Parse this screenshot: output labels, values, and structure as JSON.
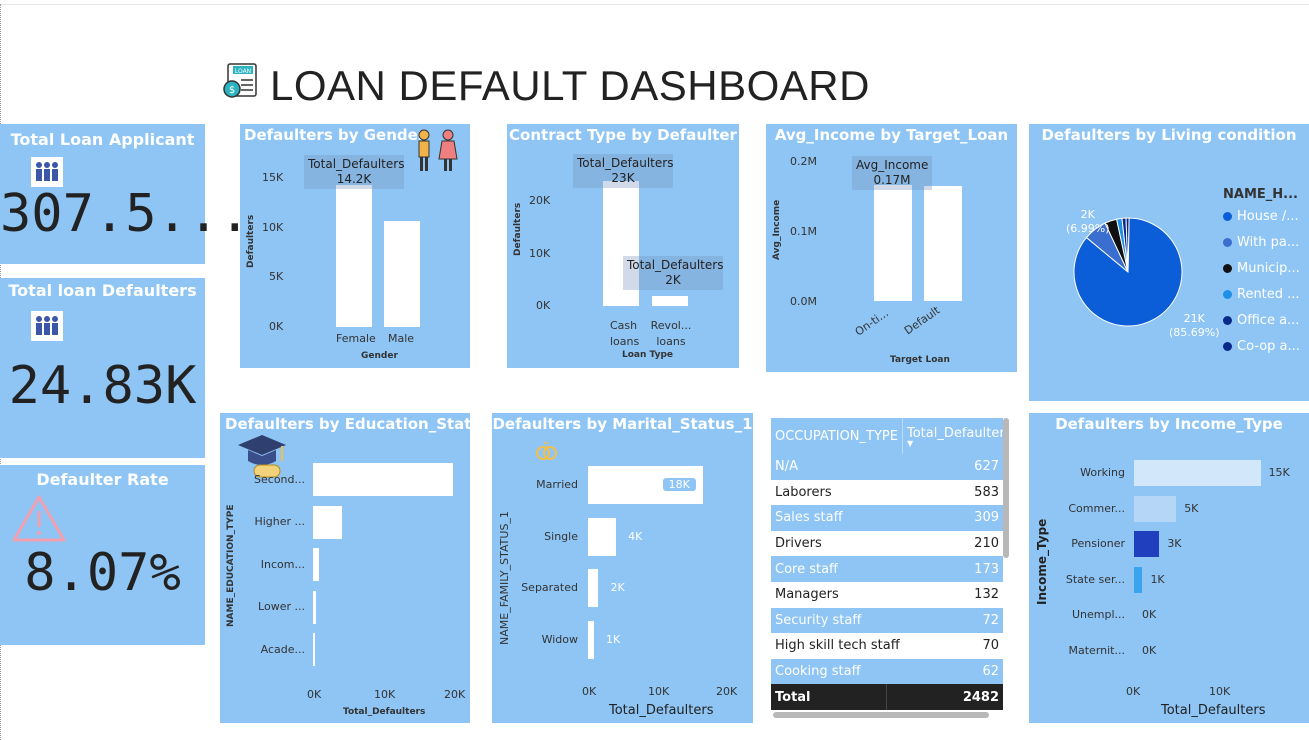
{
  "header": {
    "title": "LOAN DEFAULT DASHBOARD",
    "logo_text": "LOAN"
  },
  "kpis": {
    "applicants": {
      "title": "Total Loan Applicant",
      "value": "307.5..."
    },
    "defaulters": {
      "title": "Total loan Defaulters",
      "value": "24.83K"
    },
    "rate": {
      "title": "Defaulter Rate",
      "value": "8.07%"
    }
  },
  "colors": {
    "panel": "#8ec5f4",
    "bar": "#ffffff",
    "pie_main": "#0b5ed7",
    "dark_blue": "#1f3fbf"
  },
  "gender": {
    "title": "Defaulters by Gender",
    "ylabel": "Defaulters",
    "xlabel": "Gender",
    "ticks": [
      "15K",
      "10K",
      "5K",
      "0K"
    ],
    "tooltip_label": "Total_Defaulters",
    "tooltip_value": "14.2K",
    "chart_data": {
      "type": "bar",
      "categories": [
        "Female",
        "Male"
      ],
      "values": [
        14200,
        10600
      ],
      "ylim": [
        0,
        17000
      ]
    }
  },
  "contract": {
    "title": "Contract Type by Defaulter",
    "ylabel": "Defaulters",
    "xlabel": "Loan Type",
    "ticks": [
      "20K",
      "10K",
      "0K"
    ],
    "tooltip1_label": "Total_Defaulters",
    "tooltip1_value": "23K",
    "tooltip2_label": "Total_Defaulters",
    "tooltip2_value": "2K",
    "cat1_line1": "Cash",
    "cat1_line2": "loans",
    "cat2_line1": "Revol...",
    "cat2_line2": "loans",
    "chart_data": {
      "type": "bar",
      "categories": [
        "Cash loans",
        "Revol... loans"
      ],
      "values": [
        23000,
        2000
      ],
      "ylim": [
        0,
        25000
      ]
    }
  },
  "income_target": {
    "title": "Avg_Income by Target_Loan",
    "ylabel": "Avg_Income",
    "xlabel": "Target Loan",
    "ticks": [
      "0.2M",
      "0.1M",
      "0.0M"
    ],
    "tooltip_label": "Avg_Income",
    "tooltip_value": "0.17M",
    "cat1": "On-ti...",
    "cat2": "Default",
    "chart_data": {
      "type": "bar",
      "categories": [
        "On-ti...",
        "Default"
      ],
      "values": [
        0.17,
        0.167
      ],
      "ylim": [
        0,
        0.2
      ]
    }
  },
  "living": {
    "title": "Defaulters by Living condition",
    "legend_title": "NAME_H...",
    "legend": [
      "House /...",
      "With pa...",
      "Municip...",
      "Rented ...",
      "Office a...",
      "Co-op a..."
    ],
    "legend_colors": [
      "#0b5ed7",
      "#3a6fd0",
      "#111111",
      "#1e90e8",
      "#0a2a8a",
      "#0a2a8a"
    ],
    "label_small_value": "2K",
    "label_small_pct": "(6.99%)",
    "label_big_value": "21K",
    "label_big_pct": "(85.69%)",
    "chart_data": {
      "type": "pie",
      "categories": [
        "House /...",
        "With pa...",
        "Municip...",
        "Rented ...",
        "Office a...",
        "Co-op a..."
      ],
      "values": [
        85.69,
        6.99,
        3.6,
        1.6,
        1.2,
        0.9
      ]
    }
  },
  "education": {
    "title": "Defaulters by Education_Status",
    "ylabel": "NAME_EDUCATION_TYPE",
    "xlabel": "Total_Defaulters",
    "cats": [
      "Second...",
      "Higher ...",
      "Incom...",
      "Lower ...",
      "Acade..."
    ],
    "ticks": [
      "0K",
      "10K",
      "20K"
    ],
    "chart_data": {
      "type": "bar",
      "categories": [
        "Second...",
        "Higher ...",
        "Incom...",
        "Lower ...",
        "Acade..."
      ],
      "values": [
        19500,
        4000,
        900,
        400,
        50
      ],
      "xlim": [
        0,
        20000
      ]
    }
  },
  "marital": {
    "title": "Defaulters by Marital_Status_1",
    "ylabel": "NAME_FAMILY_STATUS_1",
    "xlabel": "Total_Defaulters",
    "cats": [
      "Married",
      "Single",
      "Separated",
      "Widow"
    ],
    "labels": [
      "18K",
      "4K",
      "2K",
      "1K"
    ],
    "ticks": [
      "0K",
      "10K",
      "20K"
    ],
    "chart_data": {
      "type": "bar",
      "categories": [
        "Married",
        "Single",
        "Separated",
        "Widow"
      ],
      "values": [
        17500,
        4300,
        1600,
        900
      ],
      "xlim": [
        0,
        20000
      ]
    }
  },
  "occupation": {
    "col1": "OCCUPATION_TYPE",
    "col2": "Total_Defaulter",
    "rows": [
      {
        "name": "N/A",
        "value": "627"
      },
      {
        "name": "Laborers",
        "value": "583"
      },
      {
        "name": "Sales staff",
        "value": "309"
      },
      {
        "name": "Drivers",
        "value": "210"
      },
      {
        "name": "Core staff",
        "value": "173"
      },
      {
        "name": "Managers",
        "value": "132"
      },
      {
        "name": "Security staff",
        "value": "72"
      },
      {
        "name": "High skill tech staff",
        "value": "70"
      },
      {
        "name": "Cooking staff",
        "value": "62"
      }
    ],
    "total_label": "Total",
    "total_value": "2482"
  },
  "income_type": {
    "title": "Defaulters by Income_Type",
    "ylabel": "Income_Type",
    "xlabel": "Total_Defaulters",
    "cats": [
      "Working",
      "Commer...",
      "Pensioner",
      "State ser...",
      "Unempl...",
      "Maternit..."
    ],
    "labels": [
      "15K",
      "5K",
      "3K",
      "1K",
      "0K",
      "0K"
    ],
    "ticks": [
      "0K",
      "10K"
    ],
    "chart_data": {
      "type": "bar",
      "categories": [
        "Working",
        "Commer...",
        "Pensioner",
        "State ser...",
        "Unempl...",
        "Maternit..."
      ],
      "values": [
        15000,
        5000,
        3000,
        1000,
        0,
        0
      ],
      "xlim": [
        0,
        16000
      ]
    }
  }
}
